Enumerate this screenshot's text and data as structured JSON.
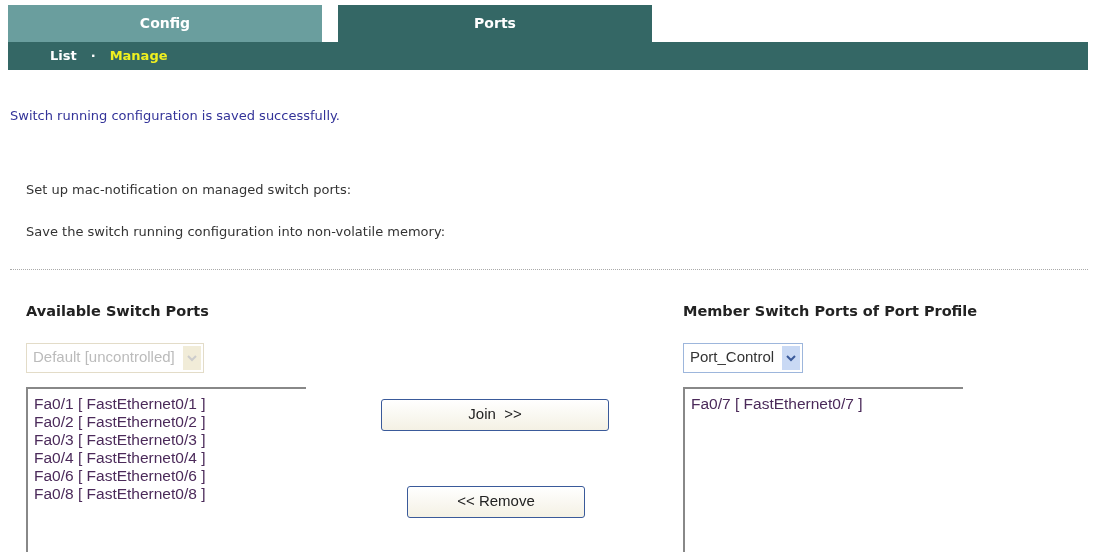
{
  "tabs": [
    {
      "label": "Config",
      "selected": false
    },
    {
      "label": "Ports",
      "selected": true
    }
  ],
  "subnav": {
    "items": [
      {
        "label": "List",
        "selected": false
      },
      {
        "label": "Manage",
        "selected": true
      }
    ],
    "separator": "·"
  },
  "message": "Switch running configuration is saved successfully.",
  "instructions": [
    "Set up mac-notification on managed switch ports:",
    "Save the switch running configuration into non-volatile memory:"
  ],
  "available": {
    "heading": "Available Switch Ports",
    "select": {
      "value": "Default [uncontrolled]",
      "disabled": true
    },
    "ports": [
      "Fa0/1 [ FastEthernet0/1 ]",
      "Fa0/2 [ FastEthernet0/2 ]",
      "Fa0/3 [ FastEthernet0/3 ]",
      "Fa0/4 [ FastEthernet0/4 ]",
      "Fa0/6 [ FastEthernet0/6 ]",
      "Fa0/8 [ FastEthernet0/8 ]"
    ]
  },
  "buttons": [
    {
      "label": "Join  >>",
      "kind": "join"
    },
    {
      "label": "<< Remove",
      "kind": "remove"
    }
  ],
  "member": {
    "heading": "Member Switch Ports of Port Profile",
    "select": {
      "value": "Port_Control",
      "disabled": false
    },
    "ports": [
      "Fa0/7 [ FastEthernet0/7 ]"
    ]
  }
}
